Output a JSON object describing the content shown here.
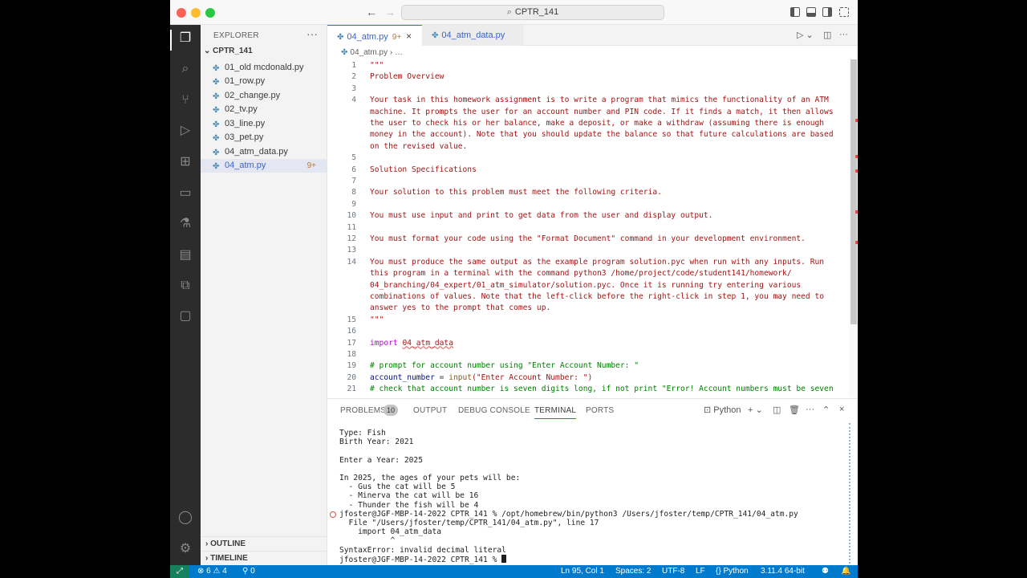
{
  "titlebar": {
    "search_label": "CPTR_141"
  },
  "activity_icons": [
    "explorer-icon",
    "search-icon",
    "source-control-icon",
    "run-debug-icon",
    "extensions-icon",
    "remote-explorer-icon",
    "testing-icon",
    "docker-icon",
    "containers-icon",
    "chat-icon",
    "account-icon",
    "settings-icon"
  ],
  "sidebar": {
    "title": "EXPLORER",
    "folder": "CPTR_141",
    "files": [
      {
        "name": "01_old mcdonald.py"
      },
      {
        "name": "01_row.py"
      },
      {
        "name": "02_change.py"
      },
      {
        "name": "02_tv.py"
      },
      {
        "name": "03_line.py"
      },
      {
        "name": "03_pet.py"
      },
      {
        "name": "04_atm_data.py"
      },
      {
        "name": "04_atm.py",
        "badge": "9+"
      }
    ],
    "outline": "OUTLINE",
    "timeline": "TIMELINE"
  },
  "tabs": [
    {
      "label": "04_atm.py",
      "badge": "9+"
    },
    {
      "label": "04_atm_data.py"
    }
  ],
  "breadcrumb": {
    "file": "04_atm.py",
    "more": "…"
  },
  "code": [
    {
      "n": "1",
      "t": "\"\"\""
    },
    {
      "n": "2",
      "t": "Problem Overview"
    },
    {
      "n": "3",
      "t": ""
    },
    {
      "n": "4",
      "t": "Your task in this homework assignment is to write a program that mimics the functionality of an ATM"
    },
    {
      "n": "",
      "t": "machine. It prompts the user for an account number and PIN code. If it finds a match, it then allows"
    },
    {
      "n": "",
      "t": "the user to check his or her balance, make a deposit, or make a withdraw (assuming there is enough"
    },
    {
      "n": "",
      "t": "money in the account). Note that you should update the balance so that future calculations are based"
    },
    {
      "n": "",
      "t": "on the revised value."
    },
    {
      "n": "5",
      "t": ""
    },
    {
      "n": "6",
      "t": "Solution Specifications"
    },
    {
      "n": "7",
      "t": ""
    },
    {
      "n": "8",
      "t": "Your solution to this problem must meet the following criteria."
    },
    {
      "n": "9",
      "t": ""
    },
    {
      "n": "10",
      "t": "You must use input and print to get data from the user and display output."
    },
    {
      "n": "11",
      "t": ""
    },
    {
      "n": "12",
      "t": "You must format your code using the \"Format Document\" command in your development environment."
    },
    {
      "n": "13",
      "t": ""
    },
    {
      "n": "14",
      "t": "You must produce the same output as the example program solution.pyc when run with any inputs. Run"
    },
    {
      "n": "",
      "t": "this program in a terminal with the command python3 /home/project/code/student141/homework/"
    },
    {
      "n": "",
      "t": "04_branching/04_expert/01_atm_simulator/solution.pyc. Once it is running try entering various"
    },
    {
      "n": "",
      "t": "combinations of values. Note that the left-click before the right-click in step 1, you may need to"
    },
    {
      "n": "",
      "t": "answer yes to the prompt that comes up."
    },
    {
      "n": "15",
      "t": "\"\"\""
    },
    {
      "n": "16",
      "t": ""
    }
  ],
  "code_tail": {
    "l17": {
      "n": "17",
      "kw": "import",
      "mod": "04_atm_data"
    },
    "l18": {
      "n": "18"
    },
    "l19": {
      "n": "19",
      "t": "# prompt for account number using \"Enter Account Number: \""
    },
    "l20": {
      "n": "20",
      "var": "account_number",
      "eq": " = ",
      "fn": "input",
      "arg": "(\"Enter Account Number: \")"
    },
    "l21": {
      "n": "21",
      "t": "# check that account number is seven digits long, if not print \"Error! Account numbers must be seven"
    }
  },
  "panel": {
    "tabs": [
      "PROBLEMS",
      "OUTPUT",
      "DEBUG CONSOLE",
      "TERMINAL",
      "PORTS"
    ],
    "problems_count": "10",
    "shell": "Python",
    "terminal": [
      "Type: Fish",
      "Birth Year: 2021",
      "",
      "Enter a Year: 2025",
      "",
      "In 2025, the ages of your pets will be:",
      "  - Gus the cat will be 5",
      "  - Minerva the cat will be 16",
      "  - Thunder the fish will be 4",
      "jfoster@JGF-MBP-14-2022 CPTR_141 % /opt/homebrew/bin/python3 /Users/jfoster/temp/CPTR_141/04_atm.py",
      "  File \"/Users/jfoster/temp/CPTR_141/04_atm.py\", line 17",
      "    import 04_atm_data",
      "           ^",
      "SyntaxError: invalid decimal literal",
      "jfoster@JGF-MBP-14-2022 CPTR_141 % "
    ]
  },
  "statusbar": {
    "errors": "6",
    "warnings": "4",
    "ports": "0",
    "position": "Ln 95, Col 1",
    "spaces": "Spaces: 2",
    "encoding": "UTF-8",
    "eol": "LF",
    "language": "Python",
    "interpreter": "3.11.4 64-bit"
  }
}
